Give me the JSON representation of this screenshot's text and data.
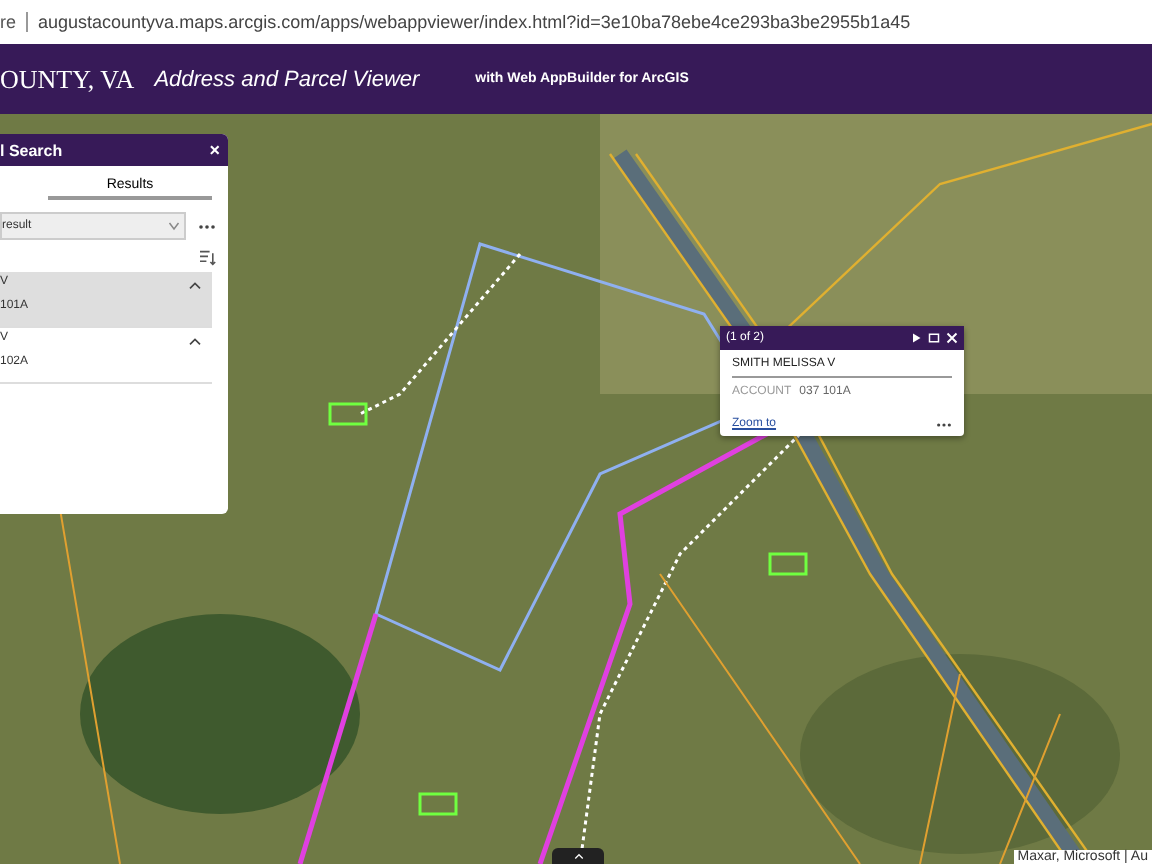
{
  "browser": {
    "prefix": "re",
    "url": "augustacountyva.maps.arcgis.com/apps/webappviewer/index.html?id=3e10ba78ebe4ce293ba3be2955b1a45"
  },
  "header": {
    "org": "OUNTY, VA",
    "title": "Address and Parcel Viewer",
    "subtitle": "with Web AppBuilder for ArcGIS"
  },
  "panel": {
    "title": "l Search",
    "close": "×",
    "tabs": [
      {
        "label": "Results",
        "selected": true
      }
    ],
    "dropdown": {
      "value": "result"
    },
    "results": [
      {
        "name": "V",
        "account": "101A",
        "selected": true
      },
      {
        "name": "V",
        "account": "102A",
        "selected": false
      }
    ]
  },
  "popup": {
    "counter": "(1 of 2)",
    "name": "SMITH MELISSA V",
    "field_label": "ACCOUNT",
    "field_value": "037 101A",
    "link": "Zoom to"
  },
  "attribution": "Maxar, Microsoft | Au"
}
